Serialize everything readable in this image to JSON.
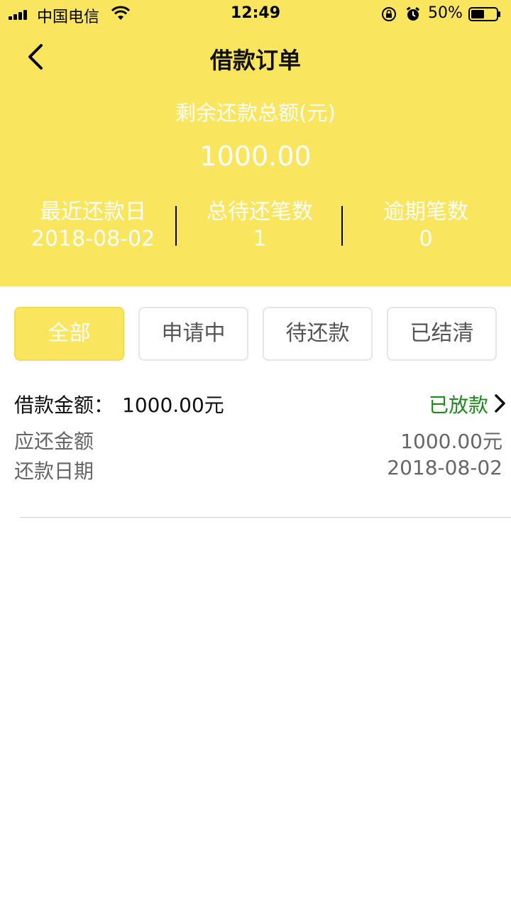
{
  "status_bar": {
    "carrier": "中国电信",
    "time": "12:49",
    "battery": "50%"
  },
  "nav": {
    "title": "借款订单",
    "back_icon": "chevron-left-icon"
  },
  "summary": {
    "remaining_label": "剩余还款总额(元)",
    "remaining_value": "1000.00",
    "stats": [
      {
        "label": "最近还款日",
        "value": "2018-08-02"
      },
      {
        "label": "总待还笔数",
        "value": "1"
      },
      {
        "label": "逾期笔数",
        "value": "0"
      }
    ]
  },
  "tabs": [
    {
      "label": "全部",
      "active": true
    },
    {
      "label": "申请中",
      "active": false
    },
    {
      "label": "待还款",
      "active": false
    },
    {
      "label": "已结清",
      "active": false
    }
  ],
  "order": {
    "amount_label": "借款金额：",
    "amount_value": "1000.00元",
    "status": "已放款",
    "rows": [
      {
        "label": "应还金额",
        "value": "1000.00元"
      },
      {
        "label": "还款日期",
        "value": "2018-08-02"
      }
    ]
  },
  "colors": {
    "header_bg": "#fae55e",
    "status_green": "#1c8a1c"
  }
}
